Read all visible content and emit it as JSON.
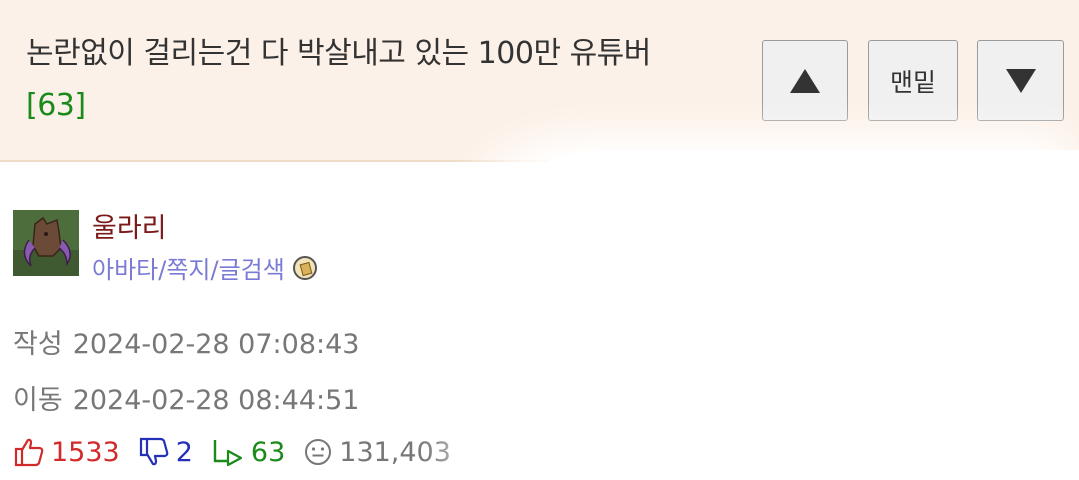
{
  "post": {
    "title": "논란없이 걸리는건 다 박살내고 있는 100만 유튜버",
    "comment_count": "[63]"
  },
  "nav": {
    "up_label": "",
    "bottom_label": "맨밑",
    "down_label": ""
  },
  "author": {
    "name": "울라리",
    "links": "아바타/쪽지/글검색"
  },
  "meta": {
    "created_label": "작성",
    "created_value": "2024-02-28 07:08:43",
    "moved_label": "이동",
    "moved_value": "2024-02-28 08:44:51"
  },
  "stats": {
    "upvotes": "1533",
    "downvotes": "2",
    "replies": "63",
    "views": "131,403"
  },
  "icons": {
    "up": "thumbs-up-icon",
    "down": "thumbs-down-icon",
    "reply": "reply-icon",
    "view": "smiley-icon"
  },
  "colors": {
    "header_bg": "#fcf1e8",
    "upvote": "#d22a2a",
    "downvote": "#2430b8",
    "reply": "#1a8a1a",
    "author": "#7a1a1a",
    "link": "#7b7bd6"
  }
}
